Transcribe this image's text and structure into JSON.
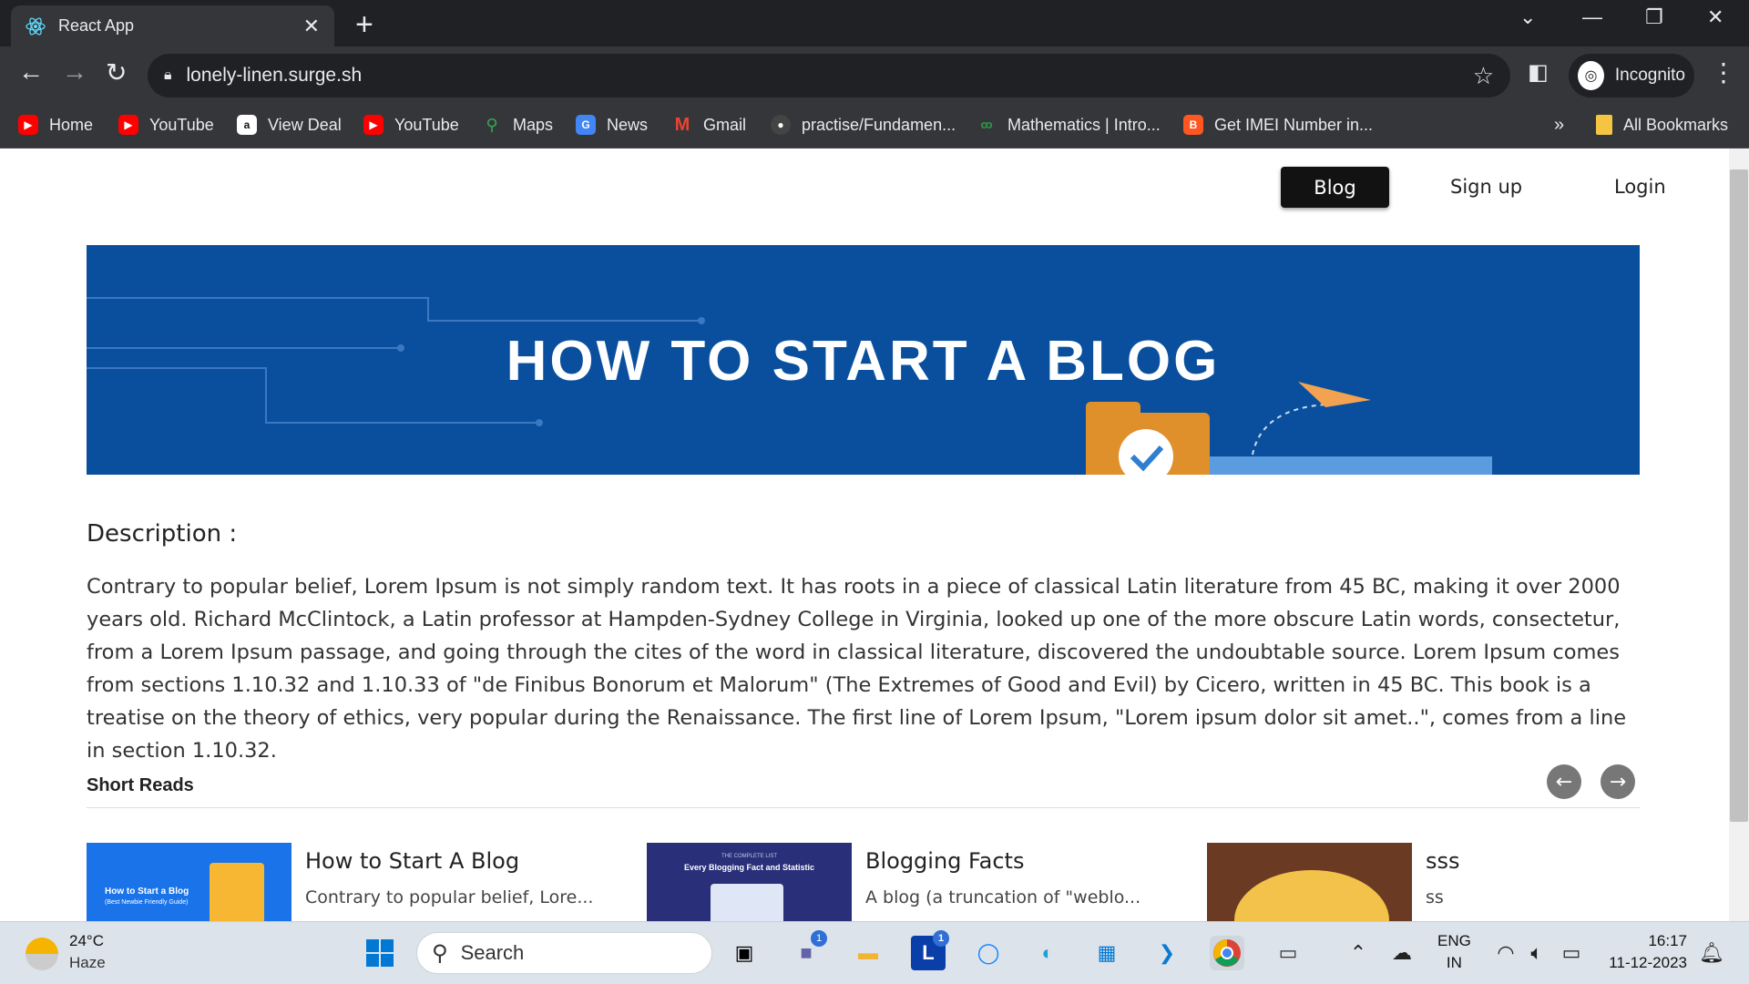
{
  "browser": {
    "tab_title": "React App",
    "url": "lonely-linen.surge.sh",
    "profile_label": "Incognito",
    "bookmarks": [
      {
        "label": "Home",
        "icon": "youtube-icon"
      },
      {
        "label": "YouTube",
        "icon": "youtube-icon"
      },
      {
        "label": "View Deal",
        "icon": "amazon-icon"
      },
      {
        "label": "YouTube",
        "icon": "youtube-icon"
      },
      {
        "label": "Maps",
        "icon": "maps-icon"
      },
      {
        "label": "News",
        "icon": "news-icon"
      },
      {
        "label": "Gmail",
        "icon": "gmail-icon"
      },
      {
        "label": "practise/Fundamen...",
        "icon": "github-icon"
      },
      {
        "label": "Mathematics | Intro...",
        "icon": "gfg-icon"
      },
      {
        "label": "Get IMEI Number in...",
        "icon": "blogger-icon"
      }
    ],
    "overflow_label": "»",
    "all_bookmarks_label": "All Bookmarks"
  },
  "site_nav": {
    "blog": "Blog",
    "signup": "Sign up",
    "login": "Login"
  },
  "banner": {
    "title": "HOW TO START A BLOG",
    "bg_color": "#0a4f9e"
  },
  "description": {
    "heading": "Description :",
    "text": "Contrary to popular belief, Lorem Ipsum is not simply random text. It has roots in a piece of classical Latin literature from 45 BC, making it over 2000 years old. Richard McClintock, a Latin professor at Hampden-Sydney College in Virginia, looked up one of the more obscure Latin words, consectetur, from a Lorem Ipsum passage, and going through the cites of the word in classical literature, discovered the undoubtable source. Lorem Ipsum comes from sections 1.10.32 and 1.10.33 of \"de Finibus Bonorum et Malorum\" (The Extremes of Good and Evil) by Cicero, written in 45 BC. This book is a treatise on the theory of ethics, very popular during the Renaissance. The first line of Lorem Ipsum, \"Lorem ipsum dolor sit amet..\", comes from a line in section 1.10.32."
  },
  "short_reads": {
    "heading": "Short Reads",
    "cards": [
      {
        "title": "How to Start A Blog",
        "excerpt": "Contrary to popular belief, Lore...",
        "thumb_caption": "How to Start a Blog",
        "thumb_sub": "(Best Newbie Friendly Guide)"
      },
      {
        "title": "Blogging Facts",
        "excerpt": "A blog (a truncation of \"weblo...",
        "thumb_caption": "Every Blogging Fact and Statistic",
        "thumb_sub": "THE COMPLETE LIST"
      },
      {
        "title": "sss",
        "excerpt": "ss"
      }
    ]
  },
  "taskbar": {
    "weather_temp": "24°C",
    "weather_desc": "Haze",
    "search_placeholder": "Search",
    "lang_line1": "ENG",
    "lang_line2": "IN",
    "time": "16:17",
    "date": "11-12-2023",
    "badge_teams": "1",
    "badge_l": "1"
  }
}
